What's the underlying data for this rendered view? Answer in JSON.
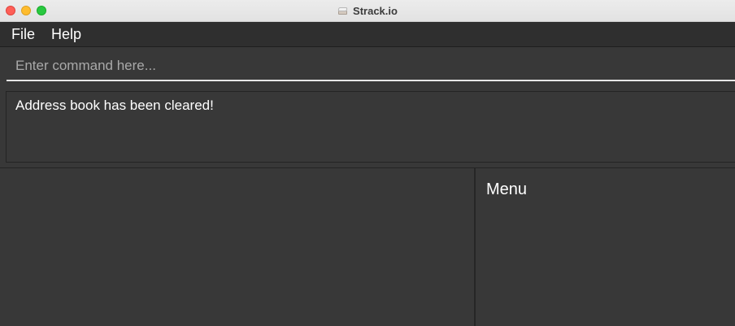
{
  "window": {
    "title": "Strack.io"
  },
  "menubar": {
    "items": [
      {
        "label": "File"
      },
      {
        "label": "Help"
      }
    ]
  },
  "command_box": {
    "value": "",
    "placeholder": "Enter command here..."
  },
  "result_display": {
    "text": "Address book has been cleared!"
  },
  "right_panel": {
    "heading": "Menu"
  },
  "colors": {
    "background": "#383838",
    "menubar": "#2f2f2f",
    "text": "#ffffff",
    "placeholder": "#a9a9a9",
    "traffic_close": "#fe5f57",
    "traffic_minimize": "#febc2e",
    "traffic_zoom": "#28c840"
  }
}
